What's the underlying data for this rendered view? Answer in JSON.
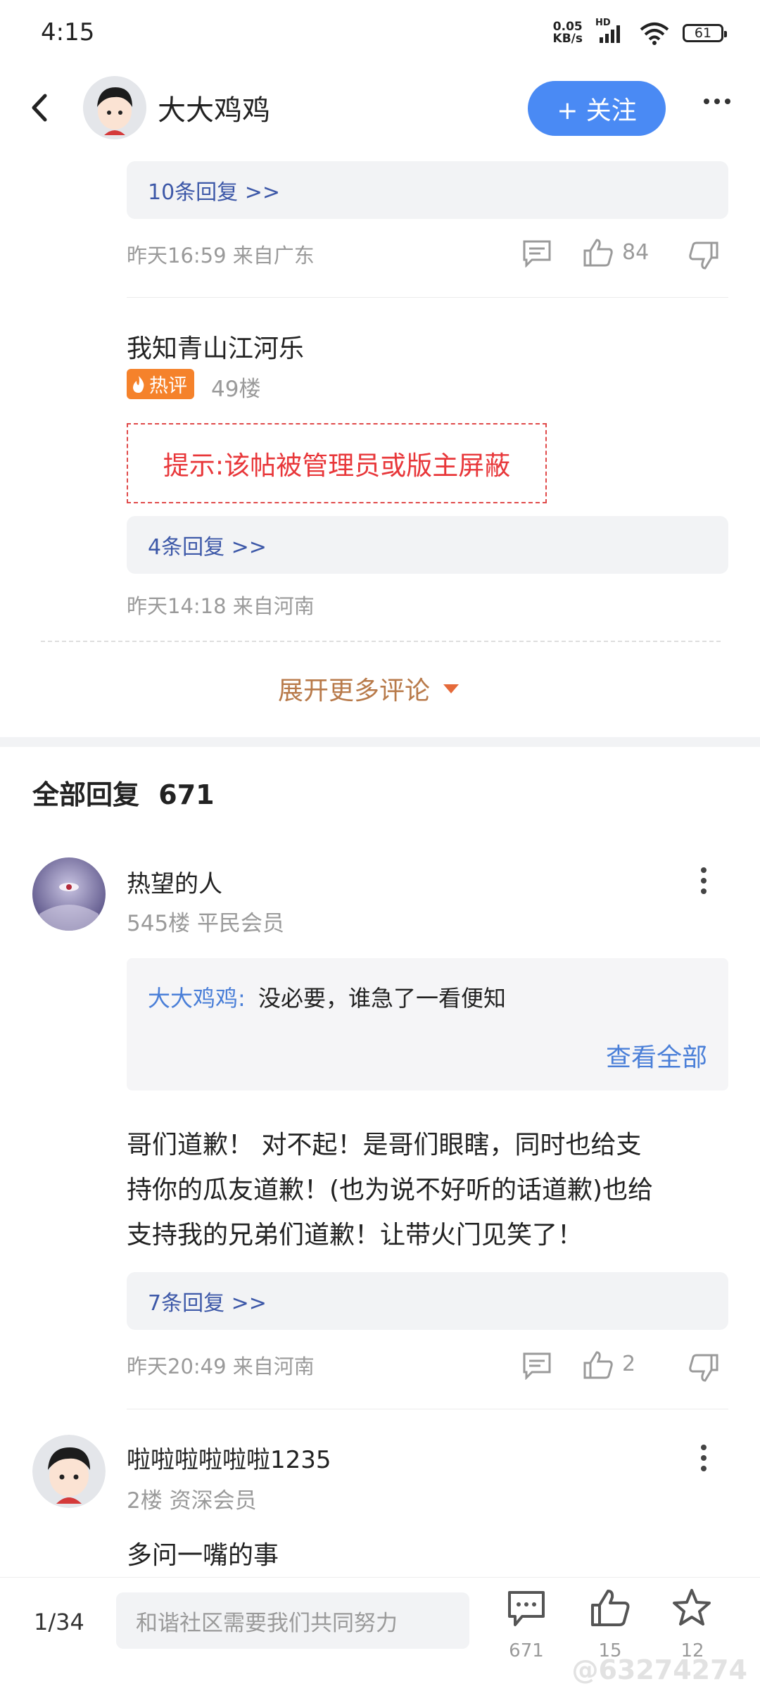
{
  "status_bar": {
    "time": "4:15",
    "speed_top": "0.05",
    "speed_bottom": "KB/s",
    "hd": "HD",
    "battery": "61"
  },
  "header": {
    "author": "大大鸡鸡",
    "follow_label": "+ 关注"
  },
  "hot_comments": [
    {
      "replies": "10条回复 >>",
      "meta": "昨天16:59 来自广东",
      "likes": "84"
    },
    {
      "username": "我知青山江河乐",
      "badge": "热评",
      "floor": "49楼",
      "blocked_notice": "提示:该帖被管理员或版主屏蔽",
      "replies": "4条回复 >>",
      "meta": "昨天14:18 来自河南"
    }
  ],
  "expand_label": "展开更多评论",
  "all_replies": {
    "title": "全部回复",
    "count": "671"
  },
  "posts": [
    {
      "username": "热望的人",
      "sub": "545楼 平民会员",
      "quote_author": "大大鸡鸡:",
      "quote_text": "没必要，谁急了一看便知",
      "view_all": "查看全部",
      "body": [
        "哥们道歉！ 对不起！是哥们眼瞎，同时也给支",
        "持你的瓜友道歉！(也为说不好听的话道歉)也给",
        "支持我的兄弟们道歉！让带火门见笑了！"
      ],
      "replies": "7条回复 >>",
      "meta": "昨天20:49 来自河南",
      "likes": "2"
    },
    {
      "username": "啦啦啦啦啦啦1235",
      "sub": "2楼 资深会员",
      "body": "多问一嘴的事"
    }
  ],
  "bottom_bar": {
    "page": "1/34",
    "placeholder": "和谐社区需要我们共同努力",
    "comments": "671",
    "likes": "15",
    "favorites": "12",
    "watermark": "@63274274"
  }
}
